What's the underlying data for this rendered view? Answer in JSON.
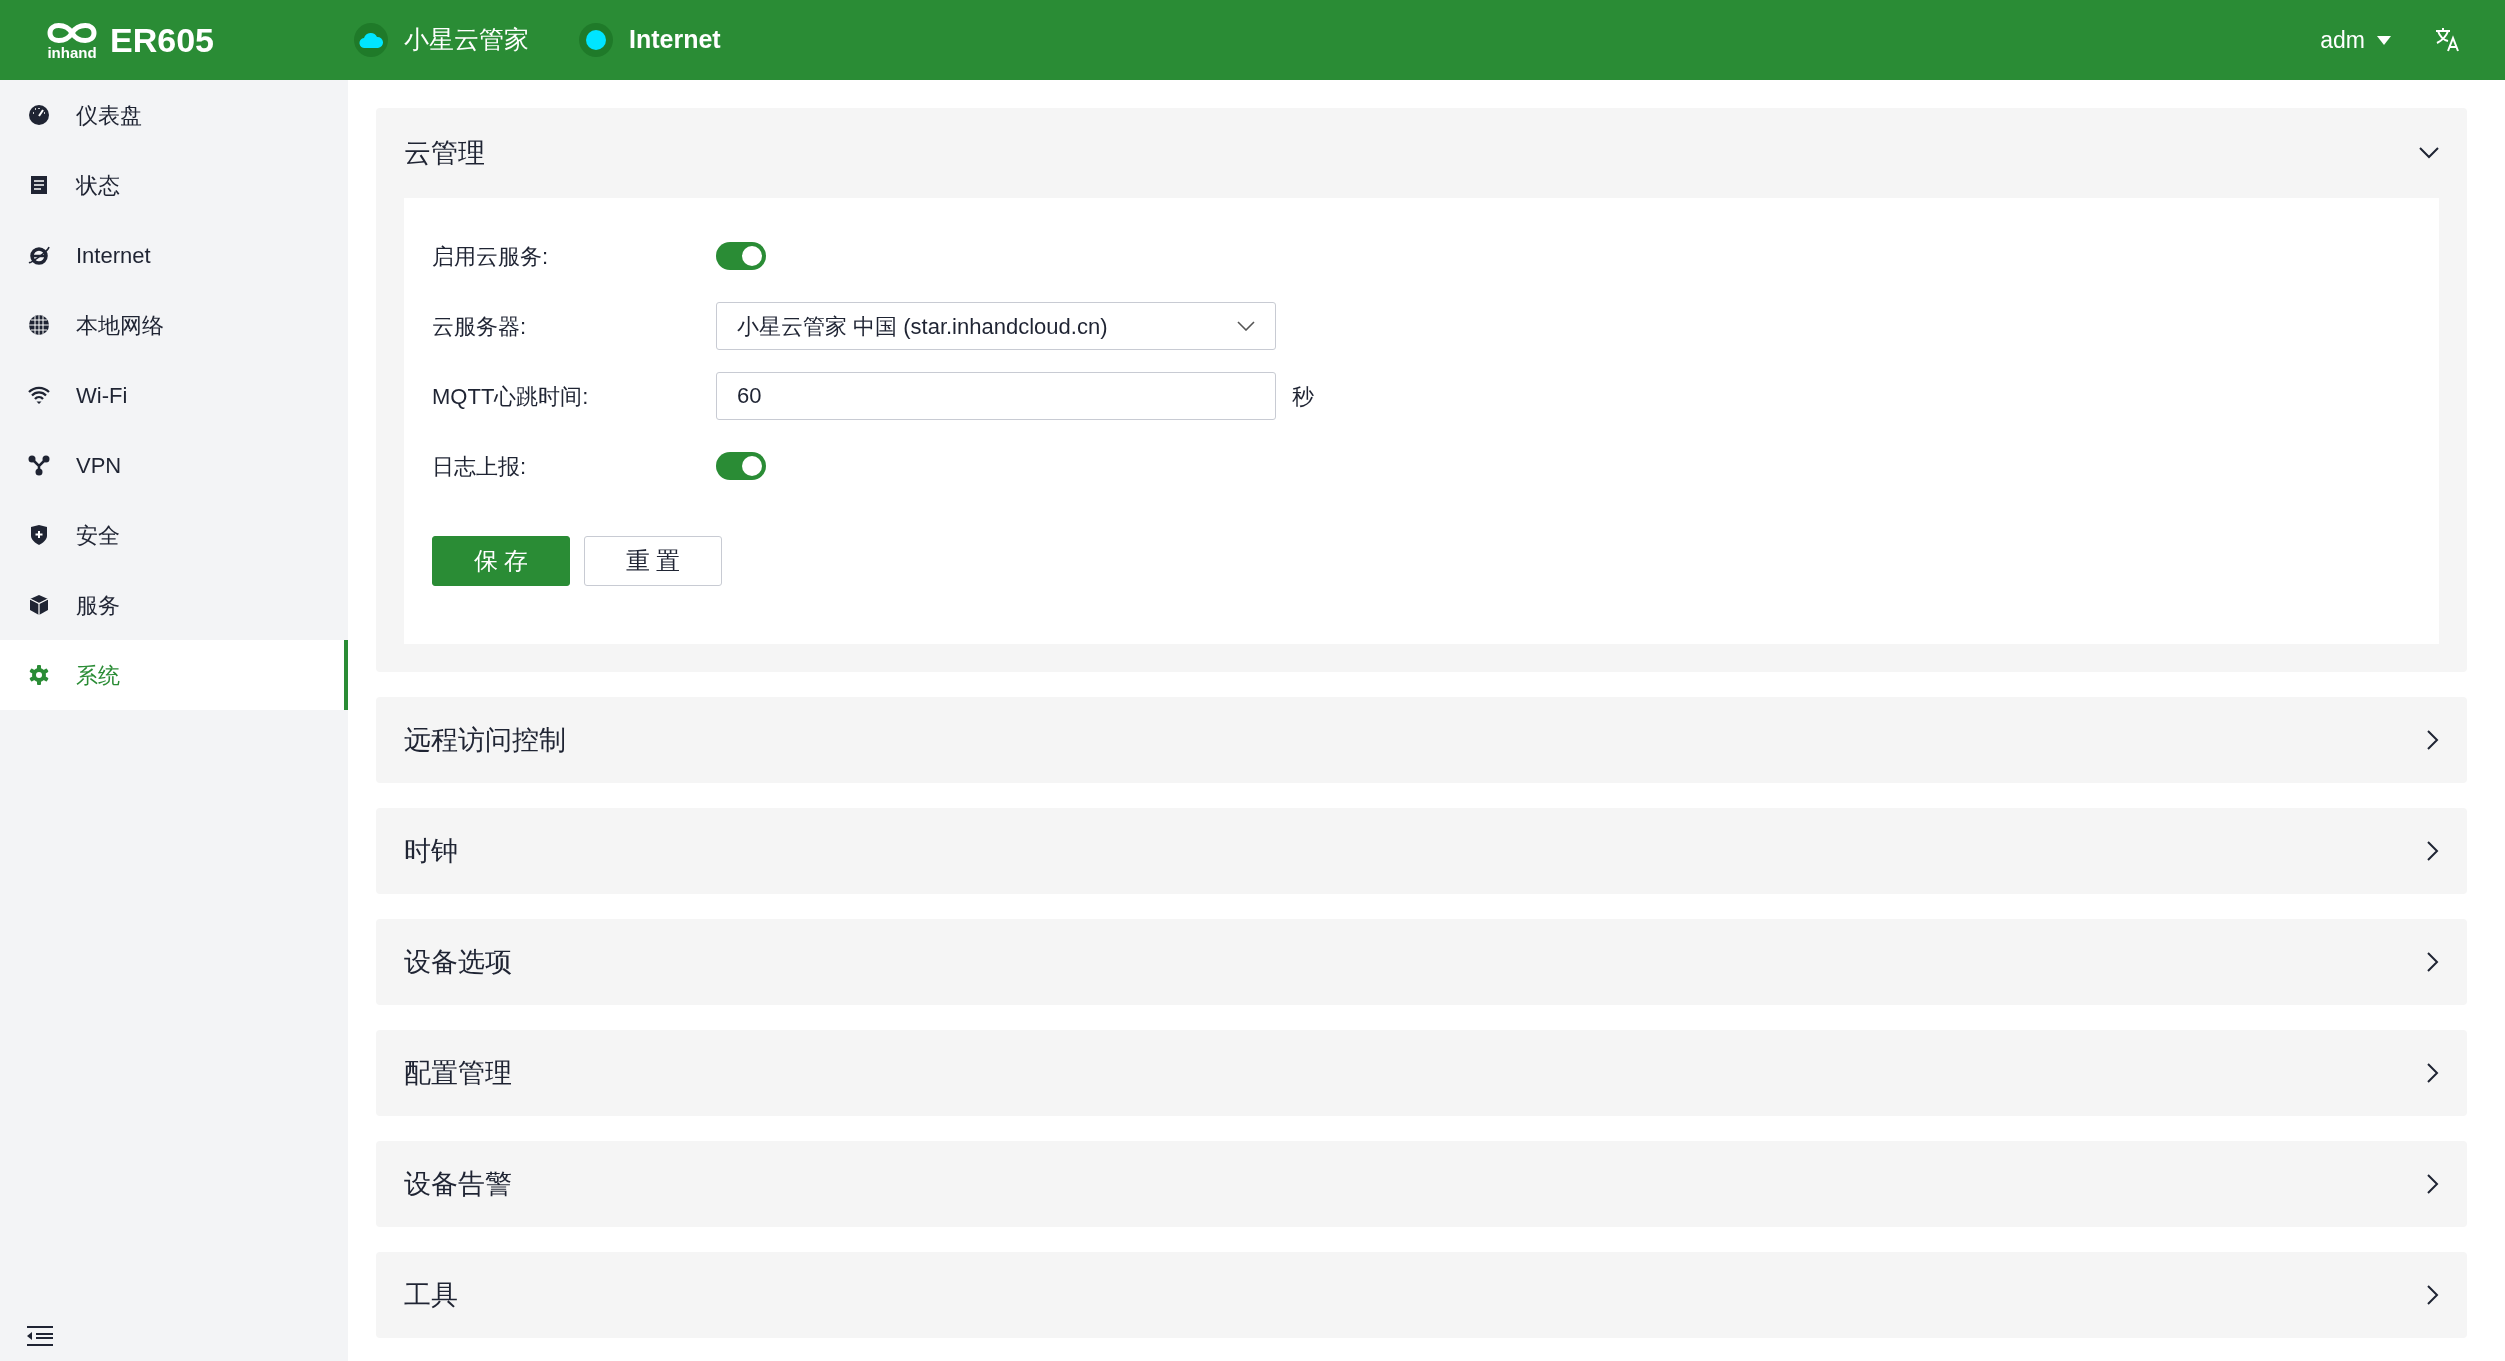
{
  "header": {
    "logo_text": "inhand",
    "product": "ER605",
    "status": [
      {
        "kind": "cloud",
        "label": "小星云管家",
        "color": "#00e5ff"
      },
      {
        "kind": "dot",
        "label": "Internet",
        "color": "#00e5ff"
      }
    ],
    "user": "adm"
  },
  "sidebar": {
    "items": [
      {
        "label": "仪表盘",
        "selected": false
      },
      {
        "label": "状态",
        "selected": false
      },
      {
        "label": "Internet",
        "selected": false
      },
      {
        "label": "本地网络",
        "selected": false
      },
      {
        "label": "Wi-Fi",
        "selected": false
      },
      {
        "label": "VPN",
        "selected": false
      },
      {
        "label": "安全",
        "selected": false
      },
      {
        "label": "服务",
        "selected": false
      },
      {
        "label": "系统",
        "selected": true
      }
    ]
  },
  "sections": [
    {
      "title": "云管理",
      "expanded": true,
      "fields": [
        {
          "kind": "toggle",
          "label": "启用云服务:",
          "on": true
        },
        {
          "kind": "select",
          "label": "云服务器:",
          "value": "小星云管家 中国 (star.inhandcloud.cn)"
        },
        {
          "kind": "input",
          "label": "MQTT心跳时间:",
          "value": "60",
          "unit": "秒"
        },
        {
          "kind": "toggle",
          "label": "日志上报:",
          "on": true
        }
      ],
      "buttons": [
        {
          "kind": "primary",
          "label": "保 存"
        },
        {
          "kind": "secondary",
          "label": "重 置"
        }
      ]
    },
    {
      "title": "远程访问控制",
      "expanded": false
    },
    {
      "title": "时钟",
      "expanded": false
    },
    {
      "title": "设备选项",
      "expanded": false
    },
    {
      "title": "配置管理",
      "expanded": false
    },
    {
      "title": "设备告警",
      "expanded": false
    },
    {
      "title": "工具",
      "expanded": false
    }
  ]
}
